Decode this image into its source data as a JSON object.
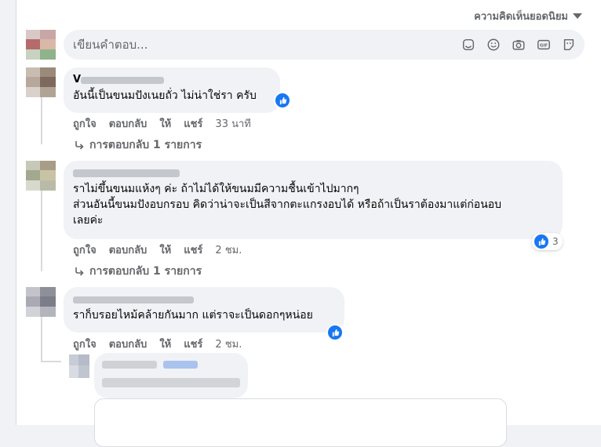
{
  "sort": {
    "label": "ความคิดเห็นยอดนิยม"
  },
  "composer": {
    "placeholder": "เขียนคำตอบ...",
    "icons": [
      "sticker-alt-icon",
      "emoji-icon",
      "camera-icon",
      "gif-icon",
      "sticker-icon"
    ]
  },
  "comments": [
    {
      "name_visible": "V",
      "text": "อันนี้เป็นขนมปังเนยถั่ว ไม่น่าใช่รา ครับ",
      "like": "ถูกใจ",
      "reply": "ตอบกลับ",
      "give": "ให้",
      "share": "แชร์",
      "time": "33 นาที",
      "replies": "การตอบกลับ 1 รายการ"
    },
    {
      "text": "ราไม่ขึ้นขนมแห้งๆ ค่ะ ถ้าไม่ได้ให้ขนมมีความชื้นเข้าไปมากๆ\nส่วนอันนี้ขนมปังอบกรอบ คิดว่าน่าจะเป็นสีจากตะแกรงอบได้ หรือถ้าเป็นราต้องมาแต่ก่อนอบ\nเลยค่ะ",
      "reaction_count": "3",
      "like": "ถูกใจ",
      "reply": "ตอบกลับ",
      "give": "ให้",
      "share": "แชร์",
      "time": "2 ชม.",
      "replies": "การตอบกลับ 1 รายการ"
    },
    {
      "text": "ราก็บรอยไหม้คล้ายกันมาก แต่ราจะเป็นดอกๆหน่อย",
      "like": "ถูกใจ",
      "reply": "ตอบกลับ",
      "give": "ให้",
      "share": "แชร์",
      "time": "2 ชม."
    }
  ],
  "colors": {
    "accent": "#1877f2",
    "secondary_text": "#65676b",
    "bubble": "#f0f2f5"
  }
}
